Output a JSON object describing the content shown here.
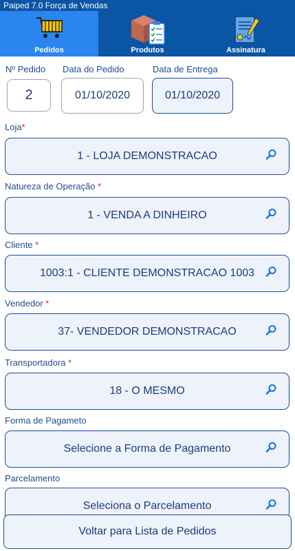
{
  "app": {
    "title": "Paiped 7.0 Força de Vendas"
  },
  "tabs": [
    {
      "label": "Pedidos",
      "icon": "shopping-cart-icon",
      "active": true
    },
    {
      "label": "Produtos",
      "icon": "product-box-icon",
      "active": false
    },
    {
      "label": "Assinatura",
      "icon": "signature-icon",
      "active": false
    }
  ],
  "header": {
    "order_number_label": "Nº Pedido",
    "order_number": "2",
    "order_date_label": "Data do Pedido",
    "order_date": "01/10/2020",
    "delivery_date_label": "Data de Entrega",
    "delivery_date": "01/10/2020"
  },
  "fields": {
    "loja": {
      "label": "Loja",
      "required": "*",
      "value": "1 - LOJA DEMONSTRACAO"
    },
    "natureza": {
      "label": "Natureza de Operação",
      "required": "*",
      "value": "1 - VENDA A DINHEIRO"
    },
    "cliente": {
      "label": "Cliente",
      "required": "*",
      "value": "1003:1 - CLIENTE DEMONSTRACAO 1003"
    },
    "vendedor": {
      "label": "Vendedor",
      "required": "*",
      "value": "37- VENDEDOR DEMONSTRACAO"
    },
    "transportadora": {
      "label": "Transportadora",
      "required": "*",
      "value": "18 - O MESMO"
    },
    "pagamento": {
      "label": "Forma de Pagameto",
      "value": "Selecione a Forma de Pagamento"
    },
    "parcelamento": {
      "label": "Parcelamento",
      "value": "Seleciona o Parcelamento"
    }
  },
  "footer": {
    "back_label": "Voltar para Lista de Pedidos"
  },
  "colors": {
    "header_bg": "#0b55a5",
    "active_tab": "#2a86ee",
    "field_bg": "#eef2fb",
    "field_border": "#1e4e8c",
    "required": "#e02424"
  }
}
